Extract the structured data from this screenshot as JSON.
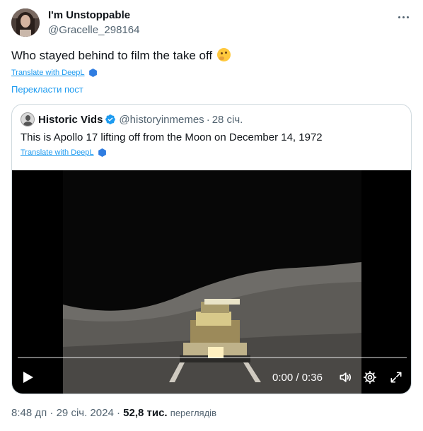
{
  "author": {
    "display_name": "I'm Unstoppable",
    "handle": "@Gracelle_298164"
  },
  "tweet": {
    "text": "Who stayed behind to film the take off",
    "emoji": "thinking-face",
    "translate_label": "Translate with DeepL",
    "translate_post_label": "Перекласти пост"
  },
  "quote": {
    "display_name": "Historic Vids",
    "handle": "@historyinmemes",
    "separator": "·",
    "date": "28 січ.",
    "text": "This is Apollo 17 lifting off from the Moon on December 14, 1972",
    "translate_label": "Translate with DeepL",
    "verified": true
  },
  "video": {
    "current_time": "0:00",
    "time_separator": "/",
    "duration": "0:36",
    "progress": 0,
    "controls": [
      "play-icon",
      "volume-icon",
      "settings-gear-icon",
      "fullscreen-icon"
    ]
  },
  "meta": {
    "time": "8:48 дп",
    "separator": "·",
    "date": "29 січ. 2024",
    "separator2": "·",
    "views_count": "52,8 тис.",
    "views_label": "переглядів"
  },
  "colors": {
    "link_blue": "#1d9bf0",
    "verified_blue": "#1d9bf0",
    "secondary_text": "#536471",
    "border": "#cfd9de"
  }
}
